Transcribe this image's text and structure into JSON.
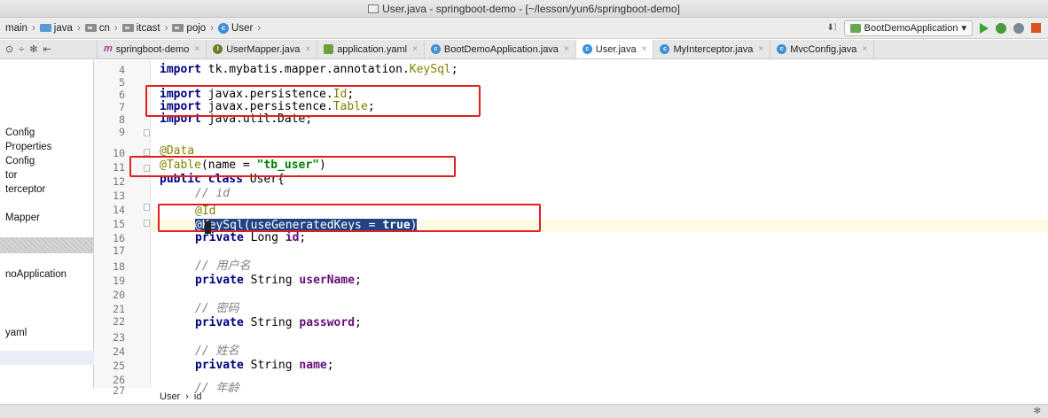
{
  "window": {
    "title": "User.java - springboot-demo - [~/lesson/yun6/springboot-demo]"
  },
  "nav": {
    "crumbs": [
      "main",
      "java",
      "cn",
      "itcast",
      "pojo",
      "User"
    ],
    "run_config": "BootDemoApplication"
  },
  "tabs": [
    {
      "label": "springboot-demo",
      "icon": "maven-icon"
    },
    {
      "label": "UserMapper.java",
      "icon": "interface-icon"
    },
    {
      "label": "application.yaml",
      "icon": "yaml-icon"
    },
    {
      "label": "BootDemoApplication.java",
      "icon": "springboot-class-icon"
    },
    {
      "label": "User.java",
      "icon": "class-icon",
      "active": true
    },
    {
      "label": "MyInterceptor.java",
      "icon": "class-icon"
    },
    {
      "label": "MvcConfig.java",
      "icon": "class-icon"
    }
  ],
  "sidebar": {
    "items": [
      "Config",
      "Properties",
      "Config",
      "tor",
      "terceptor",
      "Mapper",
      "noApplication",
      "yaml"
    ]
  },
  "editor": {
    "line_numbers": [
      "4",
      "5",
      "6",
      "7",
      "8",
      "9",
      "10",
      "11",
      "12",
      "13",
      "14",
      "15",
      "16",
      "17",
      "18",
      "19",
      "20",
      "21",
      "22",
      "23",
      "24",
      "25",
      "26",
      "27"
    ],
    "lines": {
      "l4_kw": "import",
      "l4_rest": " tk.mybatis.mapper.annotation.",
      "l4_cls": "KeySql",
      "l4_end": ";",
      "l6_kw": "import",
      "l6_rest": " javax.persistence.",
      "l6_cls": "Id",
      "l6_end": ";",
      "l7_kw": "import",
      "l7_rest": " javax.persistence.",
      "l7_cls": "Table",
      "l7_end": ";",
      "l8_kw": "import",
      "l8_rest": " java.util.Date;",
      "l10_ann": "@Data",
      "l11_ann": "@Table",
      "l11_a": "(name = ",
      "l11_str": "\"tb_user\"",
      "l11_b": ")",
      "l12_kw": "public class",
      "l12_rest": " User{",
      "l13_cm": "// id",
      "l14_ann": "@Id",
      "l15_ann": "@KeySql",
      "l15_a": "(useGeneratedKeys = ",
      "l15_kw": "true",
      "l15_b": ")",
      "l16_kw": "private",
      "l16_rest": " Long ",
      "l16_fld": "id",
      "l16_end": ";",
      "l18_cm": "// 用户名",
      "l19_kw": "private",
      "l19_rest": " String ",
      "l19_fld": "userName",
      "l19_end": ";",
      "l21_cm": "// 密码",
      "l22_kw": "private",
      "l22_rest": " String ",
      "l22_fld": "password",
      "l22_end": ";",
      "l24_cm": "// 姓名",
      "l25_kw": "private",
      "l25_rest": " String ",
      "l25_fld": "name",
      "l25_end": ";",
      "l27_cm": "// 年龄"
    }
  },
  "bottom_breadcrumb": {
    "class_name": "User",
    "member": "id"
  },
  "colors": {
    "annotation_box": "#e02020",
    "selection": "#214283"
  }
}
